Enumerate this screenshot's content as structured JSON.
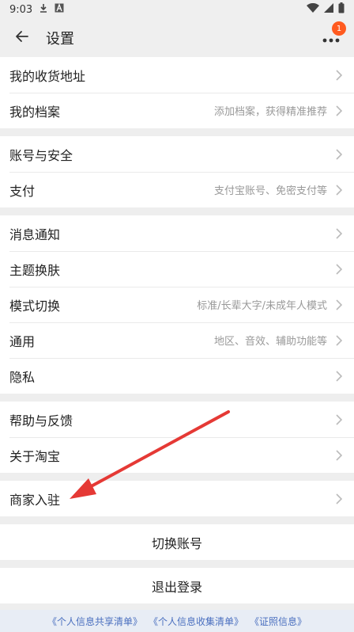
{
  "status": {
    "time": "9:03"
  },
  "header": {
    "title": "设置",
    "badge": "1"
  },
  "groups": [
    [
      {
        "label": "我的收货地址",
        "hint": ""
      },
      {
        "label": "我的档案",
        "hint": "添加档案，获得精准推荐"
      }
    ],
    [
      {
        "label": "账号与安全",
        "hint": ""
      },
      {
        "label": "支付",
        "hint": "支付宝账号、免密支付等"
      }
    ],
    [
      {
        "label": "消息通知",
        "hint": ""
      },
      {
        "label": "主题换肤",
        "hint": ""
      },
      {
        "label": "模式切换",
        "hint": "标准/长辈大字/未成年人模式"
      },
      {
        "label": "通用",
        "hint": "地区、音效、辅助功能等"
      },
      {
        "label": "隐私",
        "hint": ""
      }
    ],
    [
      {
        "label": "帮助与反馈",
        "hint": ""
      },
      {
        "label": "关于淘宝",
        "hint": ""
      }
    ],
    [
      {
        "label": "商家入驻",
        "hint": ""
      }
    ]
  ],
  "actions": {
    "switch_account": "切换账号",
    "logout": "退出登录"
  },
  "footer": {
    "link1": "《个人信息共享清单》",
    "link2": "《个人信息收集清单》",
    "link3": "《证照信息》"
  },
  "colors": {
    "accent": "#ff5a1f",
    "annotation": "#e53935",
    "link": "#4a6fbf"
  }
}
